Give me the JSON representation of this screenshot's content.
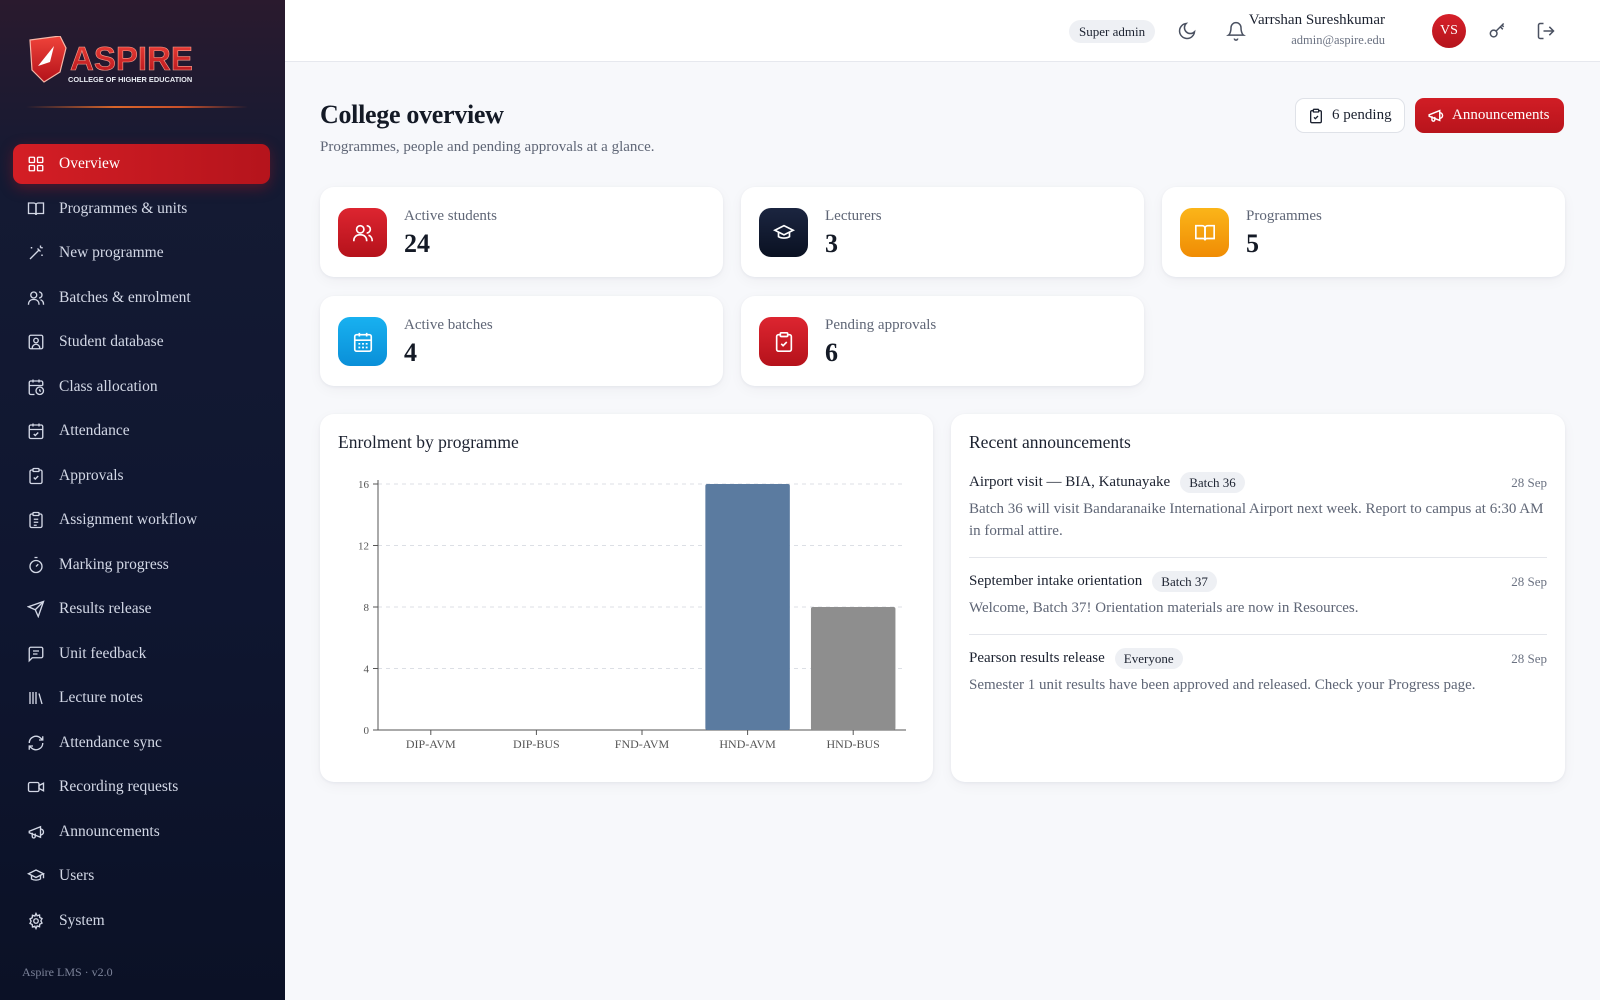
{
  "brand": {
    "name": "ASPIRE",
    "tagline": "COLLEGE OF HIGHER EDUCATION"
  },
  "sidebar": {
    "items": [
      {
        "label": "Overview",
        "icon": "grid-icon",
        "active": true
      },
      {
        "label": "Programmes & units",
        "icon": "book-icon"
      },
      {
        "label": "New programme",
        "icon": "wand-icon"
      },
      {
        "label": "Batches & enrolment",
        "icon": "users-icon"
      },
      {
        "label": "Student database",
        "icon": "id-card-icon"
      },
      {
        "label": "Class allocation",
        "icon": "calendar-clock-icon"
      },
      {
        "label": "Attendance",
        "icon": "calendar-check-icon"
      },
      {
        "label": "Approvals",
        "icon": "clipboard-check-icon"
      },
      {
        "label": "Assignment workflow",
        "icon": "clipboard-list-icon"
      },
      {
        "label": "Marking progress",
        "icon": "timer-icon"
      },
      {
        "label": "Results release",
        "icon": "send-icon"
      },
      {
        "label": "Unit feedback",
        "icon": "message-square-icon"
      },
      {
        "label": "Lecture notes",
        "icon": "library-icon"
      },
      {
        "label": "Attendance sync",
        "icon": "refresh-icon"
      },
      {
        "label": "Recording requests",
        "icon": "video-icon"
      },
      {
        "label": "Announcements",
        "icon": "megaphone-icon"
      },
      {
        "label": "Users",
        "icon": "graduation-cap-icon"
      },
      {
        "label": "System",
        "icon": "gear-icon"
      }
    ],
    "version": "Aspire LMS · v2.0"
  },
  "topbar": {
    "role": "Super admin",
    "user_name": "Varrshan Sureshkumar",
    "user_email": "admin@aspire.edu",
    "avatar_initials": "VS"
  },
  "header": {
    "title": "College overview",
    "subtitle": "Programmes, people and pending approvals at a glance.",
    "pending_label": "6 pending",
    "announcements_label": "Announcements"
  },
  "stats": [
    {
      "label": "Active students",
      "value": "24",
      "color": "#c8161e",
      "icon": "users-icon"
    },
    {
      "label": "Lecturers",
      "value": "3",
      "color": "#111a2e",
      "icon": "graduation-cap-icon"
    },
    {
      "label": "Programmes",
      "value": "5",
      "color": "#f5a20c",
      "icon": "book-icon"
    },
    {
      "label": "Active batches",
      "value": "4",
      "color": "#0ea5e9",
      "icon": "calendar-icon"
    },
    {
      "label": "Pending approvals",
      "value": "6",
      "color": "#c8161e",
      "icon": "clipboard-check-icon"
    }
  ],
  "enrolment": {
    "title": "Enrolment by programme"
  },
  "chart_data": {
    "type": "bar",
    "categories": [
      "DIP-AVM",
      "DIP-BUS",
      "FND-AVM",
      "HND-AVM",
      "HND-BUS"
    ],
    "values": [
      0,
      0,
      0,
      16,
      8
    ],
    "colors": [
      "#5b7ba0",
      "#5b7ba0",
      "#5b7ba0",
      "#5b7ba0",
      "#8e8e8e"
    ],
    "ylim": [
      0,
      16
    ],
    "yticks": [
      0,
      4,
      8,
      12,
      16
    ],
    "grid": true
  },
  "announcements": {
    "title": "Recent announcements",
    "items": [
      {
        "title": "Airport visit — BIA, Katunayake",
        "tag": "Batch 36",
        "date": "28 Sep",
        "body": "Batch 36 will visit Bandaranaike International Airport next week. Report to campus at 6:30 AM in formal attire."
      },
      {
        "title": "September intake orientation",
        "tag": "Batch 37",
        "date": "28 Sep",
        "body": "Welcome, Batch 37! Orientation materials are now in Resources."
      },
      {
        "title": "Pearson results release",
        "tag": "Everyone",
        "date": "28 Sep",
        "body": "Semester 1 unit results have been approved and released. Check your Progress page."
      }
    ]
  }
}
